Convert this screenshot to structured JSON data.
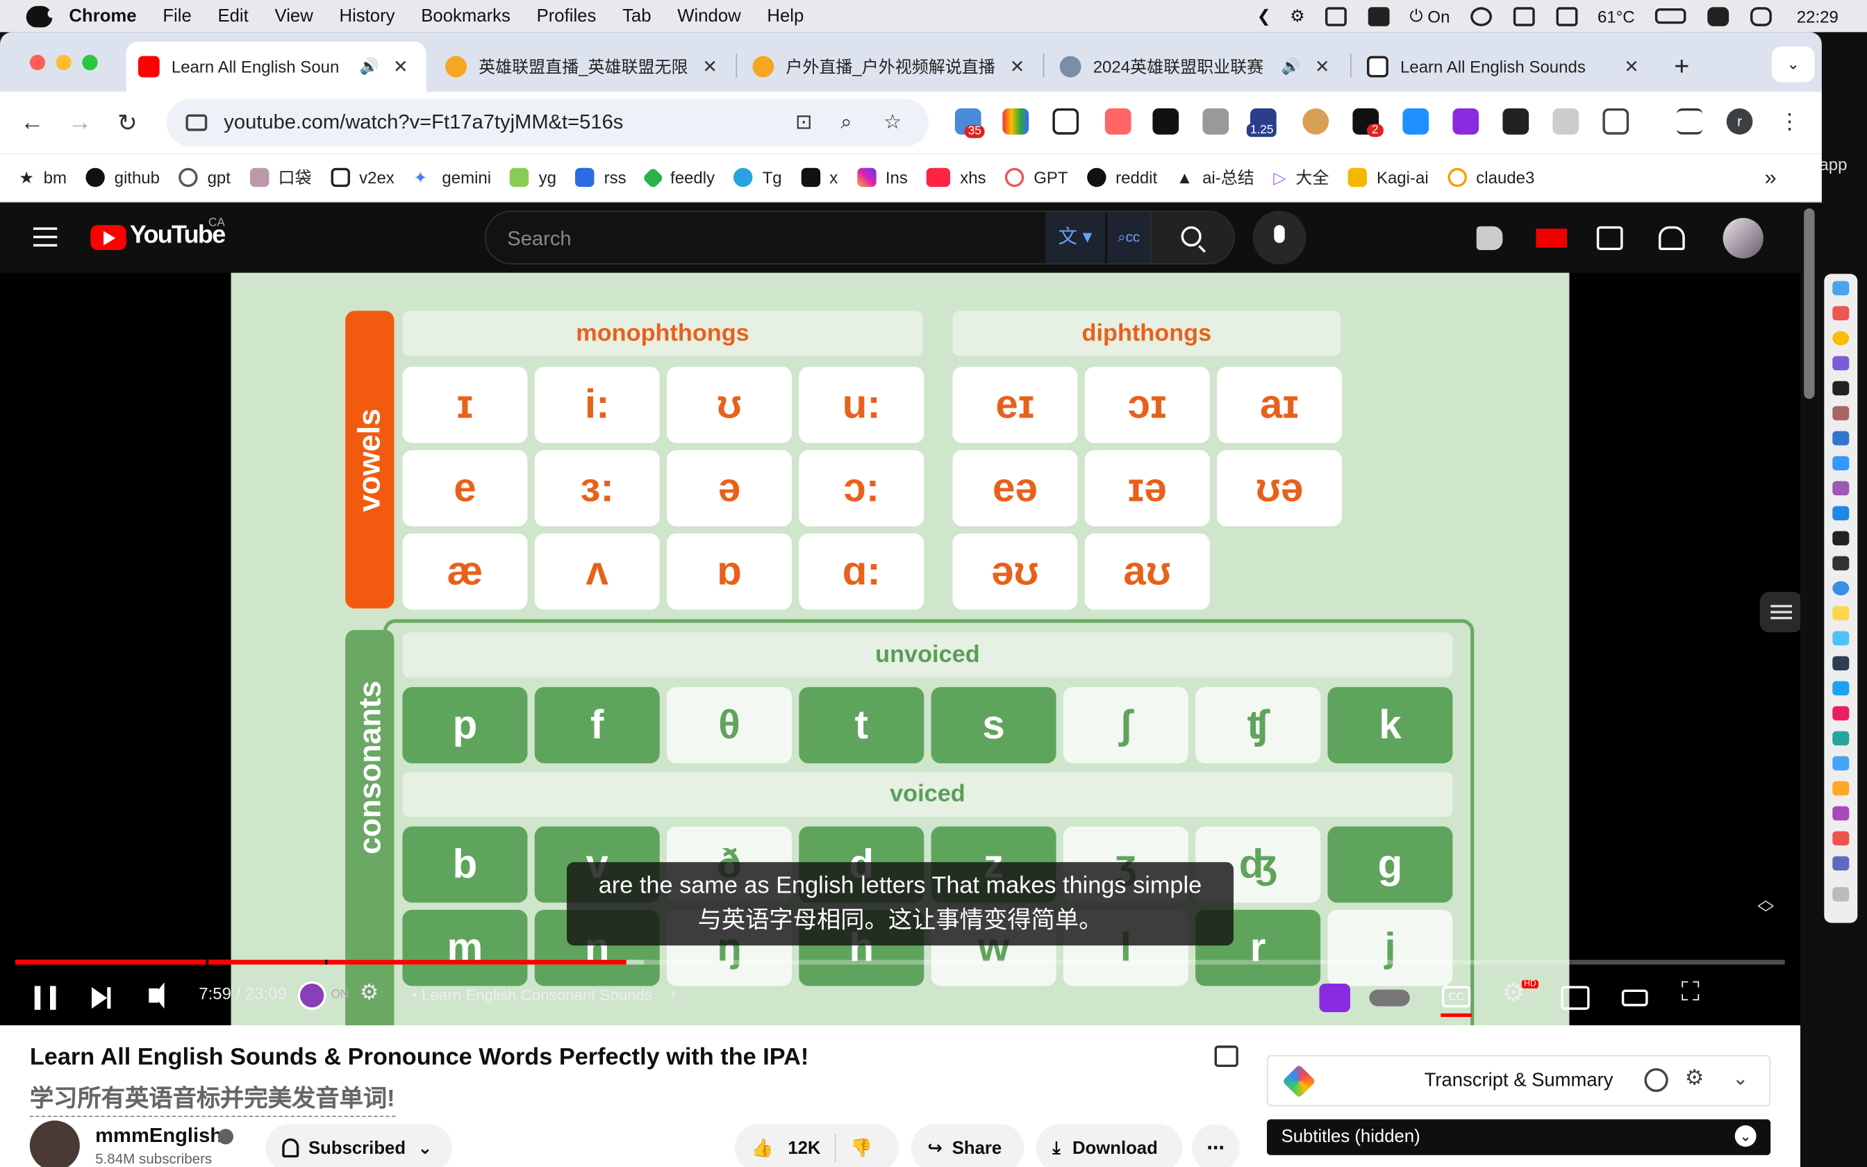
{
  "menubar": {
    "app": "Chrome",
    "items": [
      "File",
      "Edit",
      "View",
      "History",
      "Bookmarks",
      "Profiles",
      "Tab",
      "Window",
      "Help"
    ],
    "status": {
      "power": "On",
      "temp": "61°C",
      "time": "22:29"
    }
  },
  "tabs": [
    {
      "title": "Learn All English Soun",
      "active": true,
      "audio": true,
      "color": "#ff0000"
    },
    {
      "title": "英雄联盟直播_英雄联盟无限",
      "active": false,
      "audio": false,
      "color": "#f5a623"
    },
    {
      "title": "户外直播_户外视频解说直播",
      "active": false,
      "audio": false,
      "color": "#f5a623"
    },
    {
      "title": "2024英雄联盟职业联赛",
      "active": false,
      "audio": true,
      "color": "#7a8fa6"
    },
    {
      "title": "Learn All English Sounds",
      "active": false,
      "audio": false,
      "color": "#222222"
    }
  ],
  "toolbar": {
    "url": "youtube.com/watch?v=Ft17a7tyjMM&t=516s",
    "ext_badges": [
      "35",
      "1.25",
      "2"
    ],
    "profile_initial": "r"
  },
  "bookmarks": [
    "bm",
    "github",
    "gpt",
    "口袋",
    "v2ex",
    "gemini",
    "yg",
    "rss",
    "feedly",
    "Tg",
    "x",
    "Ins",
    "xhs",
    "GPT",
    "reddit",
    "ai-总结",
    "大全",
    "Kagi-ai",
    "claude3"
  ],
  "bookmarks_more": "»",
  "edge_label": "app",
  "youtube": {
    "logo_text": "YouTube",
    "country": "CA",
    "search_placeholder": "Search"
  },
  "video": {
    "chart": {
      "vowel_label": "vowels",
      "consonant_label": "consonants",
      "monophthongs_heading": "monophthongs",
      "diphthongs_heading": "diphthongs",
      "unvoiced_heading": "unvoiced",
      "voiced_heading": "voiced",
      "monophthongs": [
        "ɪ",
        "i:",
        "ʊ",
        "u:",
        "e",
        "ɜ:",
        "ə",
        "ɔ:",
        "æ",
        "ʌ",
        "ɒ",
        "ɑ:"
      ],
      "diphthongs": [
        "eɪ",
        "ɔɪ",
        "aɪ",
        "eə",
        "ɪə",
        "ʊə",
        "əʊ",
        "aʊ"
      ],
      "unvoiced": [
        "p",
        "f",
        "θ",
        "t",
        "s",
        "ʃ",
        "ʧ",
        "k"
      ],
      "voiced": [
        "b",
        "v",
        "ð",
        "d",
        "z",
        "ʒ",
        "ʤ",
        "g"
      ],
      "other": [
        "m",
        "n",
        "ŋ",
        "h",
        "w",
        "l",
        "r",
        "j"
      ]
    },
    "caption_en": "are the same as English letters That makes things simple",
    "caption_zh": "与英语字母相同。这让事情变得简单。",
    "time": "7:59 / 23:09",
    "plugin_state": "ON",
    "chapter": "• Learn English Consonant Sounds",
    "progress": 0.345,
    "buffered": 0.355
  },
  "below": {
    "title": "Learn All English Sounds & Pronounce Words Perfectly with the IPA!",
    "title_zh": "学习所有英语音标并完美发音单词!",
    "channel": "mmmEnglish",
    "subscribers": "5.84M subscribers",
    "subscribed_label": "Subscribed",
    "likes": "12K",
    "share_label": "Share",
    "download_label": "Download",
    "transcript_label": "Transcript & Summary",
    "subtitles_label": "Subtitles (hidden)"
  }
}
